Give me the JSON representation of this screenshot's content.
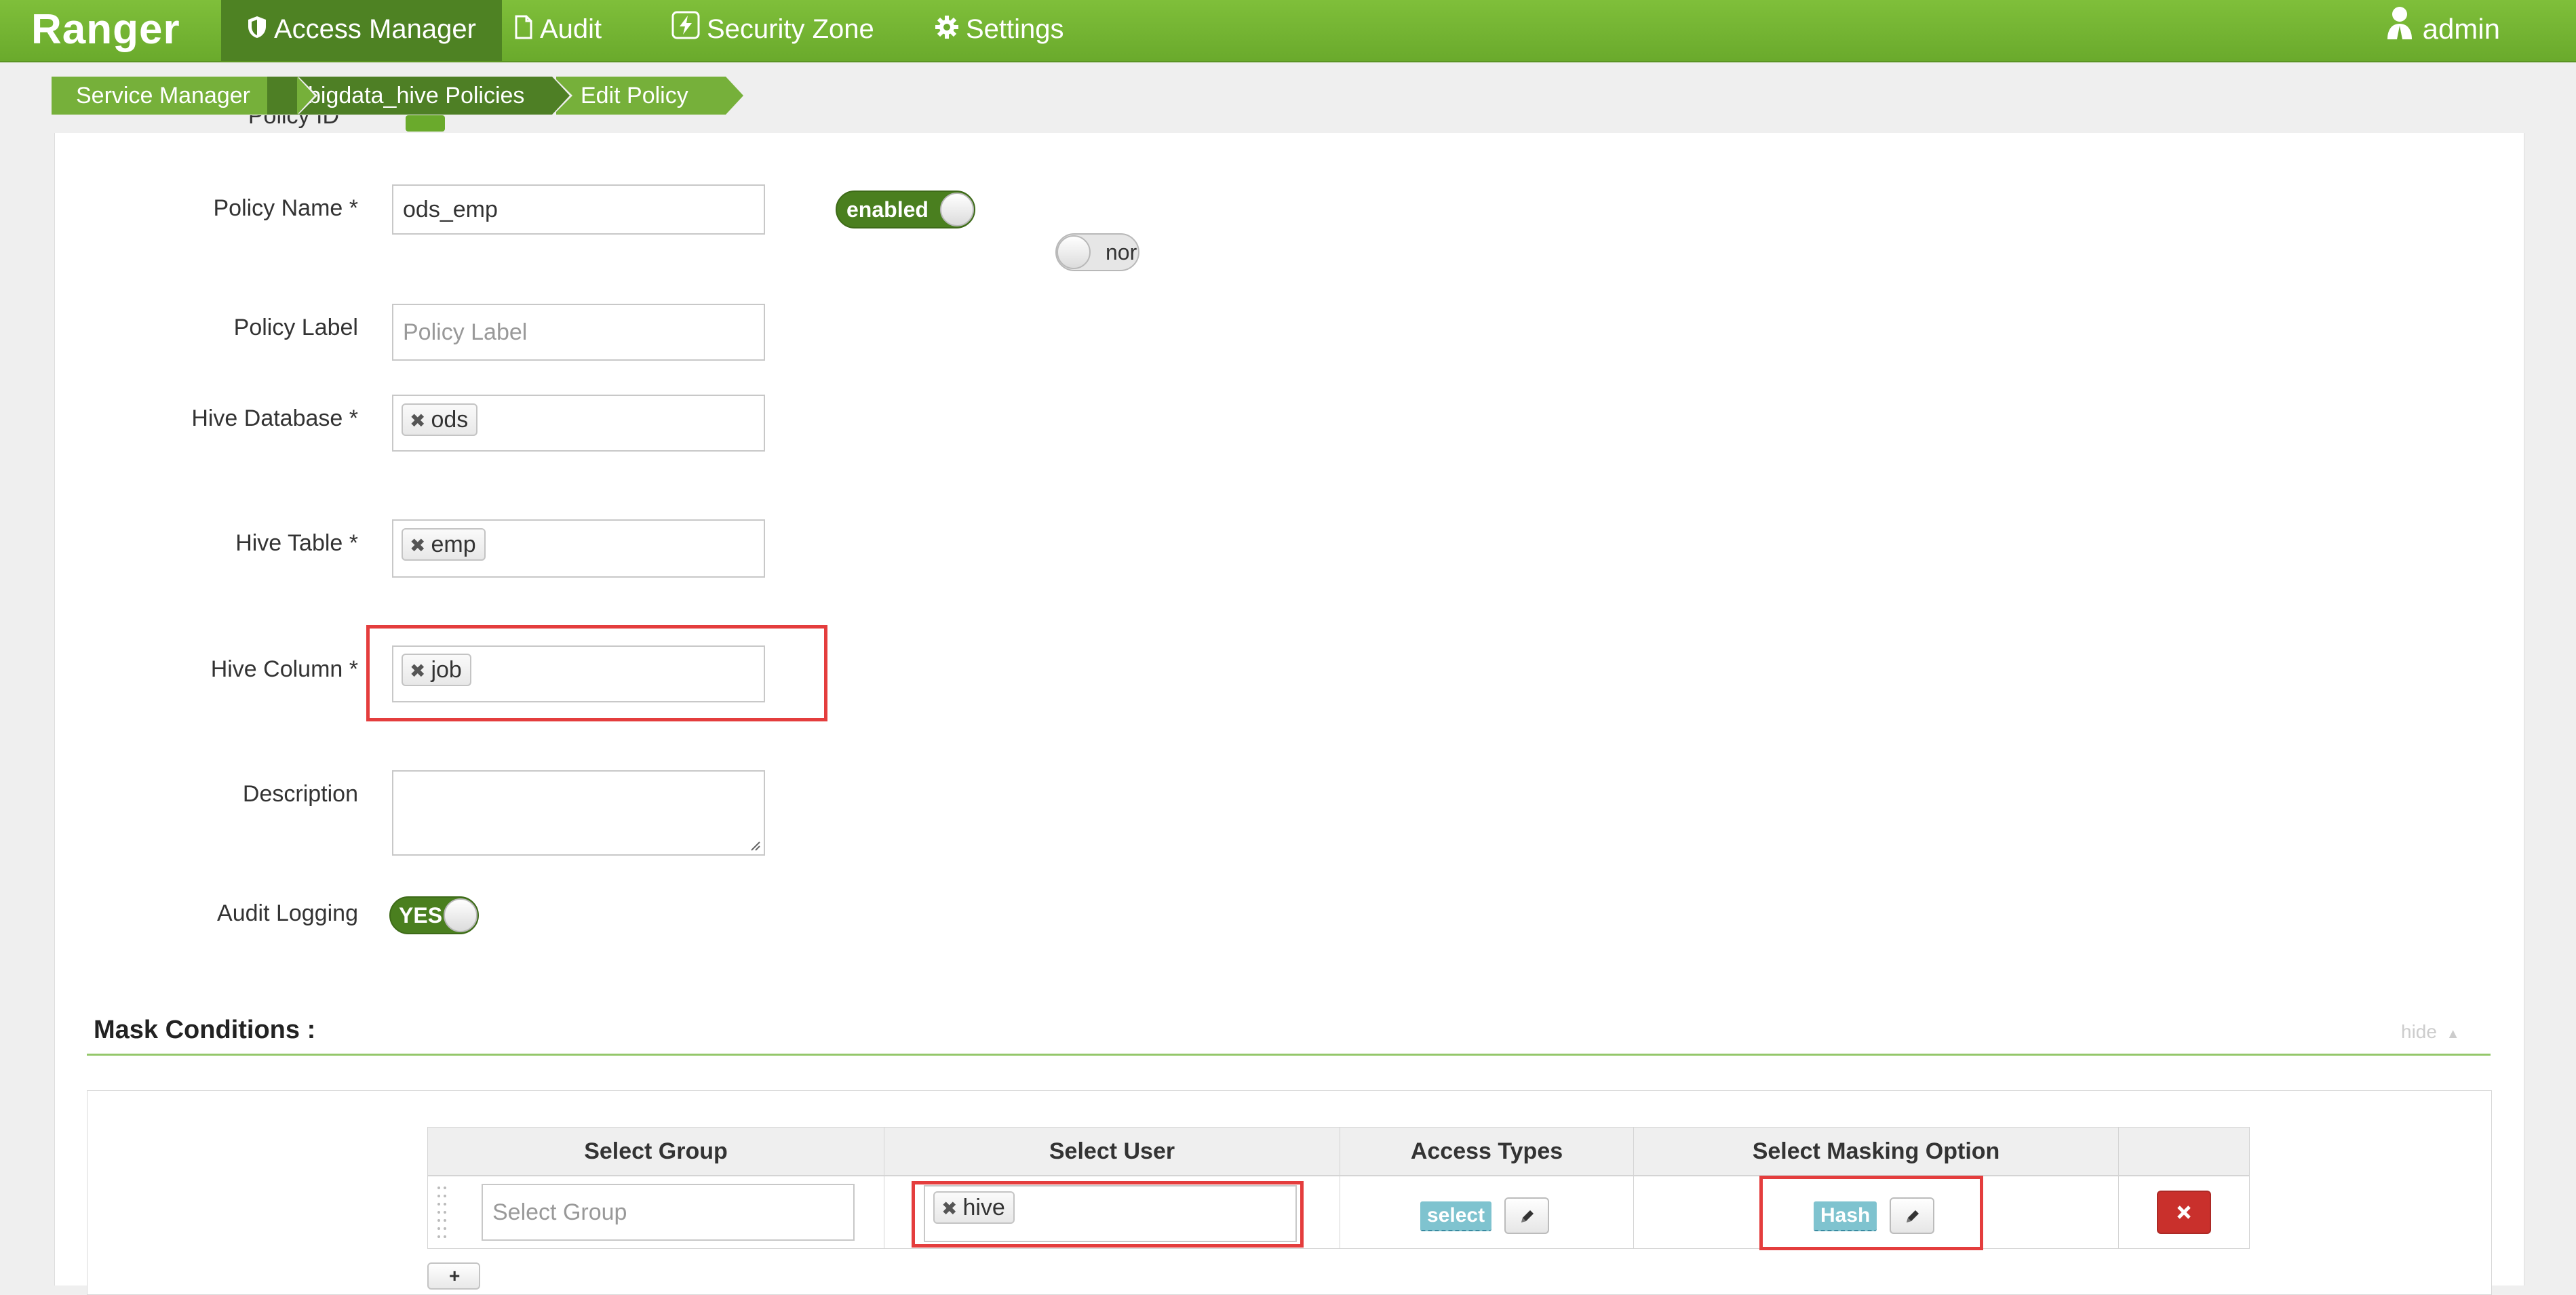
{
  "navbar": {
    "brand": "Ranger",
    "items": [
      {
        "label": "Access Manager",
        "icon": "shield-icon"
      },
      {
        "label": "Audit",
        "icon": "file-icon"
      },
      {
        "label": "Security Zone",
        "icon": "lightning-icon"
      },
      {
        "label": "Settings",
        "icon": "gear-icon"
      }
    ],
    "user": "admin"
  },
  "breadcrumb": [
    "Service Manager",
    "bigdata_hive Policies",
    "Edit Policy"
  ],
  "form": {
    "policy_id_label": "Policy ID",
    "policy_name_label": "Policy Name *",
    "policy_name_value": "ods_emp",
    "enabled_toggle": "enabled",
    "normal_toggle": "nor",
    "policy_label_label": "Policy Label",
    "policy_label_placeholder": "Policy Label",
    "hive_database_label": "Hive Database *",
    "hive_database_tag": "ods",
    "hive_table_label": "Hive Table *",
    "hive_table_tag": "emp",
    "hive_column_label": "Hive Column *",
    "hive_column_tag": "job",
    "description_label": "Description",
    "audit_logging_label": "Audit Logging",
    "audit_logging_value": "YES"
  },
  "mask": {
    "title": "Mask Conditions :",
    "hide_label": "hide",
    "columns": [
      "Select Group",
      "Select User",
      "Access Types",
      "Select Masking Option"
    ],
    "row": {
      "group_placeholder": "Select Group",
      "user_tag": "hive",
      "access_type": "select",
      "masking_option": "Hash"
    }
  },
  "colors": {
    "brand_green": "#6aaa2c",
    "highlight_red": "#e43d3d",
    "delete_red": "#c9302c"
  }
}
